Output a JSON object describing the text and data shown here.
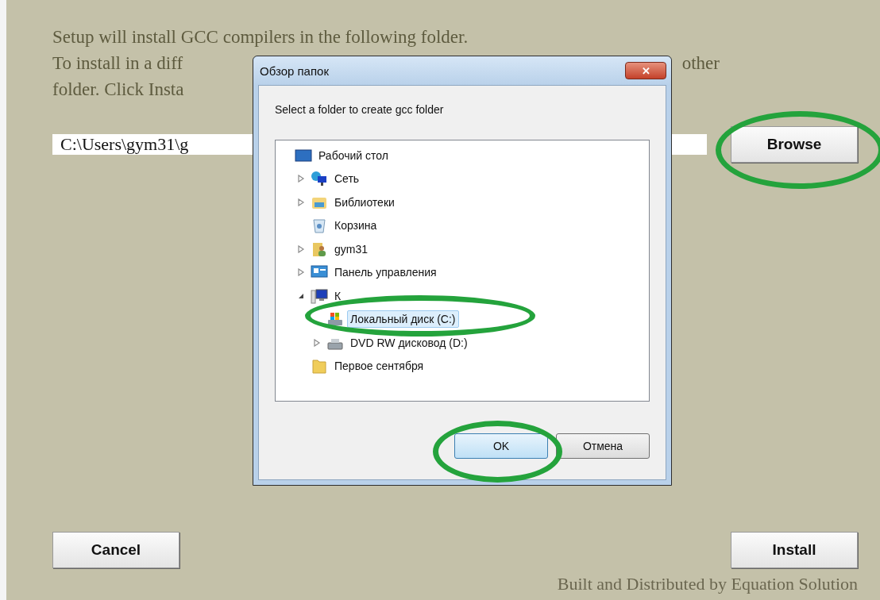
{
  "installer": {
    "intro_lines": [
      {
        "left": "Setup will install GCC compilers in the following folder."
      },
      {
        "left": "To install in a diff",
        "right": "other"
      },
      {
        "left": "folder. Click Insta"
      }
    ],
    "path_field": {
      "value": "C:\\Users\\gym31\\g"
    },
    "browse_button": "Browse",
    "cancel_button": "Cancel",
    "install_button": "Install",
    "footer": "Built and Distributed by Equation Solution"
  },
  "dialog": {
    "title": "Обзор папок",
    "close": "✕",
    "message": "Select a folder to create gcc folder",
    "tree": [
      {
        "label": "Рабочий стол",
        "kind": "desktop",
        "selected": false,
        "children": [
          {
            "label": "Сеть",
            "kind": "network",
            "expanded": false,
            "selected": false
          },
          {
            "label": "Библиотеки",
            "kind": "library",
            "expanded": false,
            "selected": false
          },
          {
            "label": "Корзина",
            "kind": "trash",
            "selected": false
          },
          {
            "label": "gym31",
            "kind": "user",
            "expanded": false,
            "selected": false
          },
          {
            "label": "Панель управления",
            "kind": "control-panel",
            "expanded": false,
            "selected": false
          },
          {
            "label": "К",
            "kind": "computer",
            "expanded": true,
            "selected": false,
            "children": [
              {
                "label": "Локальный диск (C:)",
                "kind": "drive",
                "selected": true
              },
              {
                "label": "DVD RW дисковод (D:)",
                "kind": "dvd",
                "expanded": false,
                "selected": false
              }
            ]
          },
          {
            "label": "Первое сентября",
            "kind": "folder",
            "selected": false
          }
        ]
      }
    ],
    "ok_button": "OK",
    "cancel_button": "Отмена"
  }
}
